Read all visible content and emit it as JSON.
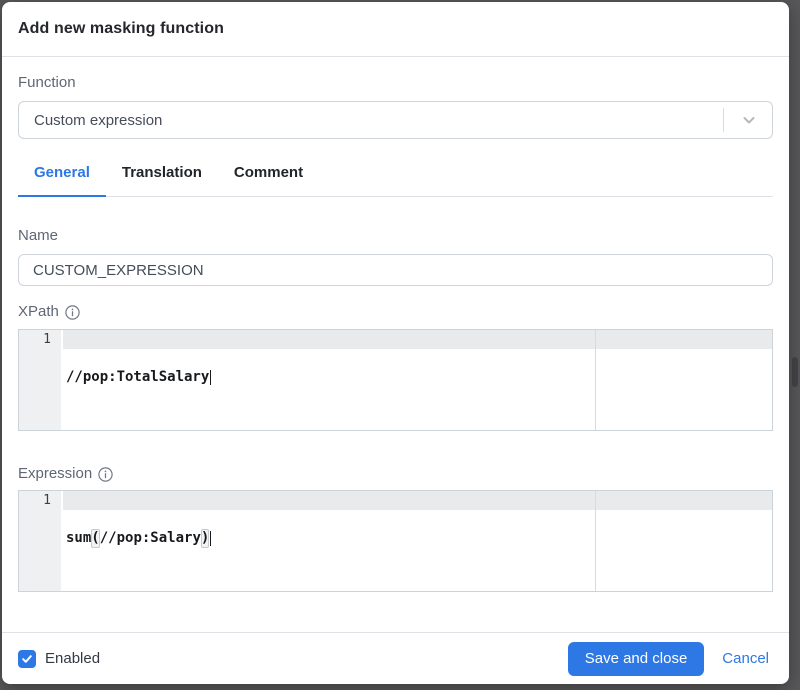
{
  "dialog": {
    "title": "Add new masking function"
  },
  "function_field": {
    "label": "Function",
    "value": "Custom expression"
  },
  "tabs": [
    {
      "label": "General",
      "active": true
    },
    {
      "label": "Translation",
      "active": false
    },
    {
      "label": "Comment",
      "active": false
    }
  ],
  "name_field": {
    "label": "Name",
    "value": "CUSTOM_EXPRESSION"
  },
  "xpath_editor": {
    "label": "XPath",
    "line_number": "1",
    "code": "//pop:TotalSalary"
  },
  "expression_editor": {
    "label": "Expression",
    "line_number": "1",
    "code_prefix": "sum",
    "open_paren": "(",
    "code_inner": "//pop:Salary",
    "close_paren": ")"
  },
  "footer": {
    "enabled_label": "Enabled",
    "enabled_checked": true,
    "save_label": "Save and close",
    "cancel_label": "Cancel"
  },
  "icons": {
    "chevron": "chevron-down-icon",
    "info": "info-icon",
    "check": "check-icon"
  },
  "colors": {
    "accent_blue": "#2d78e4",
    "backdrop": "#58585a"
  }
}
